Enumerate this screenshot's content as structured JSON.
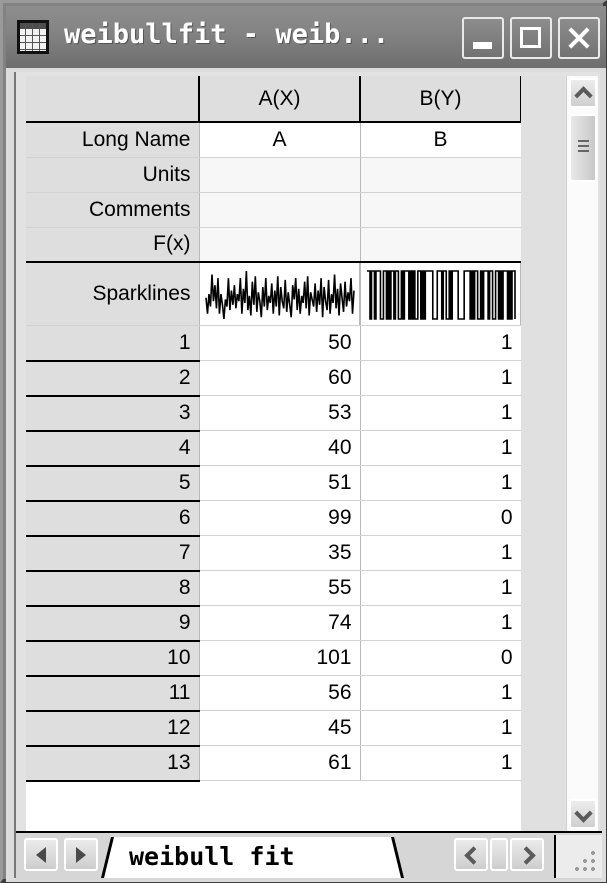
{
  "window": {
    "title": "weibullfit - weib...",
    "icon": "worksheet-icon",
    "buttons": {
      "minimize": "_",
      "maximize": "□",
      "close": "X"
    }
  },
  "worksheet": {
    "corner_label": "",
    "columns": [
      {
        "header": "A(X)",
        "long_name": "A",
        "units": "",
        "comments": "",
        "fx": ""
      },
      {
        "header": "B(Y)",
        "long_name": "B",
        "units": "",
        "comments": "",
        "fx": ""
      }
    ],
    "meta_rows": [
      {
        "label": "Long Name",
        "values": [
          "A",
          "B"
        ]
      },
      {
        "label": "Units",
        "values": [
          "",
          ""
        ]
      },
      {
        "label": "Comments",
        "values": [
          "",
          ""
        ]
      },
      {
        "label": "F(x)",
        "values": [
          "",
          ""
        ]
      },
      {
        "label": "Sparklines",
        "values": [
          "",
          ""
        ]
      }
    ],
    "data_rows": [
      {
        "index": "1",
        "a": "50",
        "b": "1"
      },
      {
        "index": "2",
        "a": "60",
        "b": "1"
      },
      {
        "index": "3",
        "a": "53",
        "b": "1"
      },
      {
        "index": "4",
        "a": "40",
        "b": "1"
      },
      {
        "index": "5",
        "a": "51",
        "b": "1"
      },
      {
        "index": "6",
        "a": "99",
        "b": "0"
      },
      {
        "index": "7",
        "a": "35",
        "b": "1"
      },
      {
        "index": "8",
        "a": "55",
        "b": "1"
      },
      {
        "index": "9",
        "a": "74",
        "b": "1"
      },
      {
        "index": "10",
        "a": "101",
        "b": "0"
      },
      {
        "index": "11",
        "a": "56",
        "b": "1"
      },
      {
        "index": "12",
        "a": "45",
        "b": "1"
      },
      {
        "index": "13",
        "a": "61",
        "b": "1"
      }
    ]
  },
  "sparklines": {
    "a": [
      48,
      30,
      52,
      38,
      74,
      44,
      62,
      36,
      70,
      30,
      52,
      40,
      24,
      46,
      38,
      70,
      34,
      56,
      40,
      62,
      36,
      52,
      44,
      70,
      30,
      58,
      42,
      78,
      34,
      50,
      28,
      66,
      40,
      72,
      32,
      54,
      44,
      26,
      60,
      38,
      70,
      34,
      50,
      42,
      64,
      30,
      56,
      38,
      72,
      28,
      60,
      44,
      36,
      68,
      32,
      54,
      40,
      26,
      62,
      46,
      70,
      34,
      58,
      30,
      50,
      42,
      66,
      36,
      72,
      28,
      54,
      46,
      38,
      64,
      32,
      56,
      40,
      70,
      26,
      60,
      44,
      34,
      68,
      30,
      52,
      42,
      74,
      36,
      58,
      28,
      64,
      48,
      32,
      66,
      38,
      54,
      44,
      70,
      30,
      56
    ],
    "b": [
      95,
      95,
      8,
      95,
      95,
      8,
      95,
      95,
      95,
      8,
      8,
      95,
      95,
      8,
      95,
      8,
      95,
      95,
      8,
      95,
      95,
      8,
      8,
      95,
      8,
      95,
      95,
      95,
      8,
      95,
      8,
      95,
      8,
      8,
      95,
      95,
      8,
      95,
      8,
      95,
      95,
      95,
      95,
      95,
      8,
      8,
      8,
      95,
      95,
      95,
      8,
      95,
      95,
      8,
      8,
      95,
      8,
      95,
      95,
      95,
      95,
      8,
      8,
      8,
      8,
      95,
      95,
      95,
      95,
      8,
      95,
      8,
      95,
      95,
      8,
      8,
      95,
      8,
      95,
      95,
      95,
      8,
      95,
      95,
      8,
      8,
      95,
      95,
      8,
      95,
      8,
      95,
      95,
      95,
      8,
      95,
      8,
      95,
      95,
      8
    ]
  },
  "statusbar": {
    "nav_prev": "◀",
    "nav_next": "▶",
    "active_tab": "weibull fit",
    "hscroll_left": "◀",
    "hscroll_right": "▶"
  }
}
